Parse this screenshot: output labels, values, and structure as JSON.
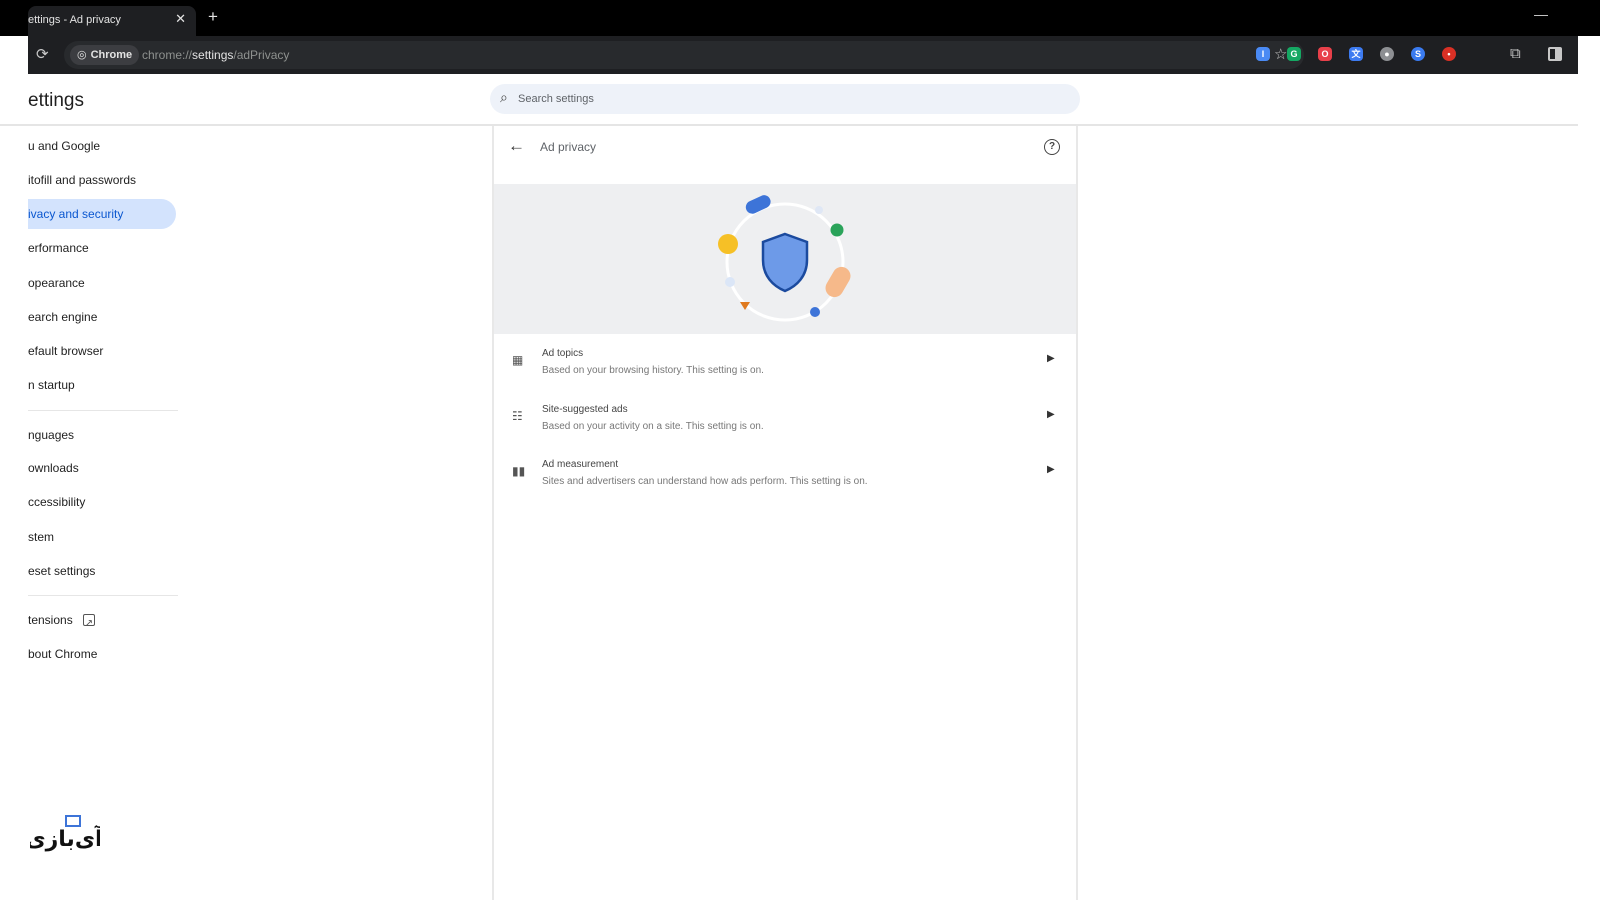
{
  "browser": {
    "tab_title": "ettings - Ad privacy",
    "tab_close": "✕",
    "new_tab": "+",
    "minimize": "—",
    "site_chip": "Chrome",
    "url_prefix": "chrome://",
    "url_host": "settings",
    "url_path": "/adPrivacy",
    "extensions": [
      {
        "name": "extension-blue",
        "glyph": "I",
        "color": "#4a8af4"
      },
      {
        "name": "extension-grammarly",
        "glyph": "G",
        "color": "#15a863"
      },
      {
        "name": "extension-red",
        "glyph": "O",
        "color": "#e8404a"
      },
      {
        "name": "extension-translate",
        "glyph": "文",
        "color": "#3d7bf1"
      },
      {
        "name": "extension-gray",
        "glyph": "●",
        "color": "#8d8f93"
      },
      {
        "name": "extension-blue-round",
        "glyph": "S",
        "color": "#3a7bf0"
      },
      {
        "name": "extension-red-small",
        "glyph": "•",
        "color": "#d93025"
      }
    ]
  },
  "settings": {
    "title": "ettings",
    "search_placeholder": "Search settings"
  },
  "sidebar": {
    "items": [
      {
        "label": "u and Google"
      },
      {
        "label": "itofill and passwords"
      },
      {
        "label": "ivacy and security",
        "active": true
      },
      {
        "label": "erformance"
      },
      {
        "label": "opearance"
      },
      {
        "label": "earch engine"
      },
      {
        "label": "efault browser"
      },
      {
        "label": "n startup"
      },
      {
        "label": "nguages"
      },
      {
        "label": "ownloads"
      },
      {
        "label": "ccessibility"
      },
      {
        "label": "stem"
      },
      {
        "label": "eset settings"
      },
      {
        "label": "tensions",
        "external": true
      },
      {
        "label": "bout Chrome"
      }
    ]
  },
  "page": {
    "title": "Ad privacy",
    "help_glyph": "?",
    "rows": [
      {
        "title": "Ad topics",
        "subtitle": "Based on your browsing history. This setting is on.",
        "icon": "ad-topics-icon"
      },
      {
        "title": "Site-suggested ads",
        "subtitle": "Based on your activity on a site. This setting is on.",
        "icon": "site-suggested-icon"
      },
      {
        "title": "Ad measurement",
        "subtitle": "Sites and advertisers can understand how ads perform. This setting is on.",
        "icon": "bar-chart-icon"
      }
    ]
  },
  "logo": {
    "text": "آی‌بازی"
  }
}
